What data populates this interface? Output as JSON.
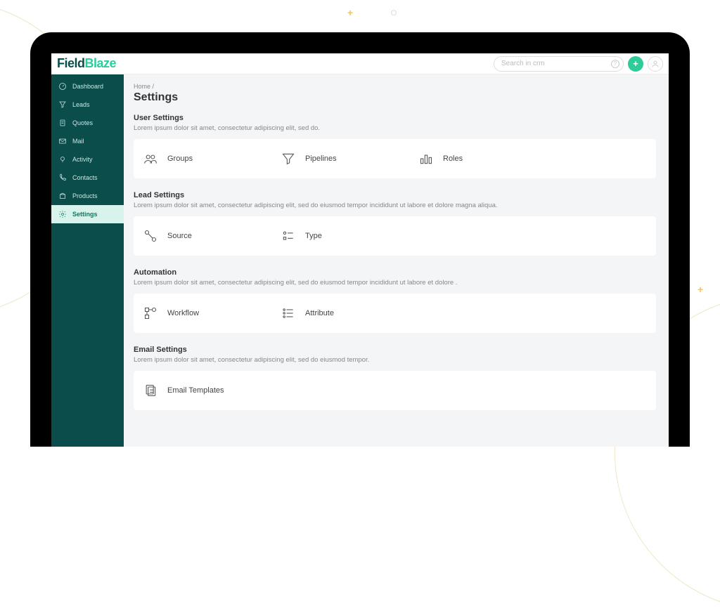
{
  "logo": {
    "part1": "Field",
    "part2": "Blaze"
  },
  "search": {
    "placeholder": "Search in crm",
    "help": "?"
  },
  "add_button": "+",
  "sidebar": {
    "items": [
      {
        "label": "Dashboard"
      },
      {
        "label": "Leads"
      },
      {
        "label": "Quotes"
      },
      {
        "label": "Mail"
      },
      {
        "label": "Activity"
      },
      {
        "label": "Contacts"
      },
      {
        "label": "Products"
      },
      {
        "label": "Settings"
      }
    ]
  },
  "breadcrumb": "Home /",
  "page_title": "Settings",
  "sections": [
    {
      "title": "User Settings",
      "desc": "Lorem ipsum dolor sit amet, consectetur adipiscing elit, sed do."
    },
    {
      "title": "Lead Settings",
      "desc": "Lorem ipsum dolor sit amet, consectetur adipiscing elit, sed do eiusmod tempor incididunt ut labore et dolore magna aliqua."
    },
    {
      "title": "Automation",
      "desc": "Lorem ipsum dolor sit amet, consectetur adipiscing elit, sed do eiusmod tempor incididunt ut labore et dolore ."
    },
    {
      "title": "Email Settings",
      "desc": "Lorem ipsum dolor sit amet, consectetur adipiscing elit, sed do eiusmod tempor."
    }
  ],
  "cards": {
    "user": [
      {
        "label": "Groups"
      },
      {
        "label": "Pipelines"
      },
      {
        "label": "Roles"
      }
    ],
    "lead": [
      {
        "label": "Source"
      },
      {
        "label": "Type"
      }
    ],
    "automation": [
      {
        "label": "Workflow"
      },
      {
        "label": "Attribute"
      }
    ],
    "email": [
      {
        "label": "Email Templates"
      }
    ]
  }
}
